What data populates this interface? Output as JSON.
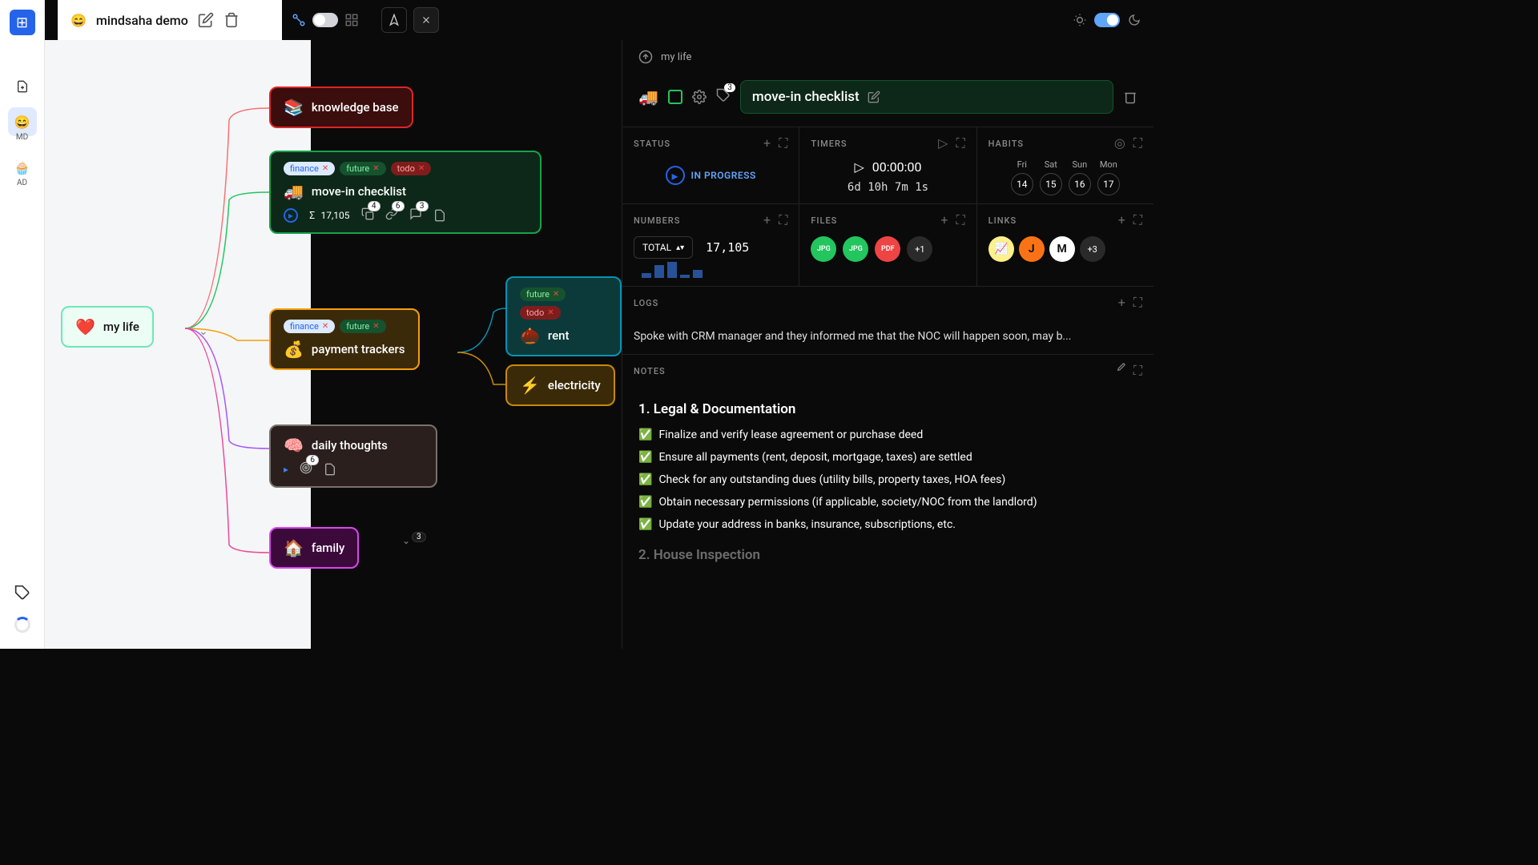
{
  "app": {
    "title": "mindsaha demo"
  },
  "sidebar": {
    "projects": [
      {
        "emoji": "😄",
        "label": "MD"
      },
      {
        "emoji": "🧁",
        "label": "AD"
      }
    ]
  },
  "canvas": {
    "root": {
      "emoji": "❤️",
      "title": "my life"
    },
    "nodes": {
      "knowledge": {
        "emoji": "📚",
        "title": "knowledge base"
      },
      "movein": {
        "tags": [
          "finance",
          "future",
          "todo"
        ],
        "emoji": "🚚",
        "title": "move-in checklist",
        "sum": "17,105",
        "counts": {
          "copy": "4",
          "link": "6",
          "comment": "3"
        }
      },
      "payment": {
        "tags": [
          "finance",
          "future"
        ],
        "emoji": "💰",
        "title": "payment trackers"
      },
      "rent": {
        "tags": [
          "future",
          "todo"
        ],
        "emoji": "🌰",
        "title": "rent"
      },
      "electricity": {
        "emoji": "⚡",
        "title": "electricity"
      },
      "thoughts": {
        "emoji": "🧠",
        "title": "daily thoughts",
        "count": "6"
      },
      "family": {
        "emoji": "🏠",
        "title": "family",
        "count": "3"
      }
    }
  },
  "detail": {
    "crumb": "my life",
    "emoji": "🚚",
    "title": "move-in checklist",
    "tag_count": "3",
    "status": {
      "label": "STATUS",
      "value": "IN PROGRESS"
    },
    "timers": {
      "label": "TIMERS",
      "main": "00:00:00",
      "sub": "6d 10h 7m 1s"
    },
    "habits": {
      "label": "HABITS",
      "days": [
        {
          "d": "Fri",
          "n": "14"
        },
        {
          "d": "Sat",
          "n": "15"
        },
        {
          "d": "Sun",
          "n": "16"
        },
        {
          "d": "Mon",
          "n": "17"
        }
      ]
    },
    "numbers": {
      "label": "NUMBERS",
      "total_label": "TOTAL",
      "value": "17,105",
      "bars": [
        6,
        16,
        20,
        4,
        10
      ]
    },
    "files": {
      "label": "FILES",
      "items": [
        {
          "ext": "JPG",
          "color": "#22c55e"
        },
        {
          "ext": "JPG",
          "color": "#22c55e"
        },
        {
          "ext": "PDF",
          "color": "#ef4444"
        }
      ],
      "more": "+1"
    },
    "links": {
      "label": "LINKS",
      "items": [
        {
          "glyph": "📈",
          "bg": "#fef08a"
        },
        {
          "glyph": "J",
          "bg": "#f97316"
        },
        {
          "glyph": "M",
          "bg": "#fff"
        }
      ],
      "more": "+3"
    },
    "logs": {
      "label": "LOGS",
      "text": "Spoke with CRM manager and they informed me that the NOC will happen soon, may b..."
    },
    "notes": {
      "label": "NOTES",
      "heading1": "1. Legal & Documentation",
      "items1": [
        "Finalize and verify lease agreement or purchase deed",
        "Ensure all payments (rent, deposit, mortgage, taxes) are settled",
        "Check for any outstanding dues (utility bills, property taxes, HOA fees)",
        "Obtain necessary permissions (if applicable, society/NOC from the landlord)",
        "Update your address in banks, insurance, subscriptions, etc."
      ],
      "heading2": "2. House Inspection"
    }
  }
}
